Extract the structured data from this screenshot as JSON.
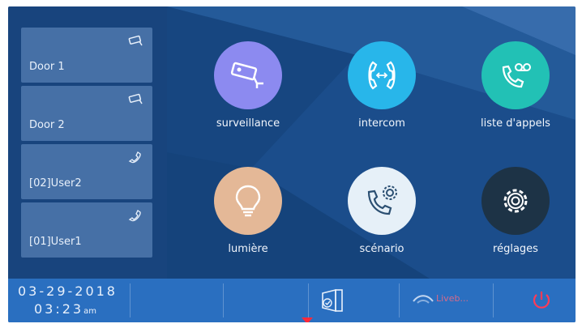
{
  "tiles": [
    {
      "label": "Door 1",
      "icon": "camera-icon"
    },
    {
      "label": "Door 2",
      "icon": "camera-icon"
    },
    {
      "label": "[02]User2",
      "icon": "phone-icon"
    },
    {
      "label": "[01]User1",
      "icon": "phone-icon"
    }
  ],
  "apps": [
    {
      "label": "surveillance",
      "color": "#8c8af0",
      "icon": "camera-icon"
    },
    {
      "label": "intercom",
      "color": "#28b6ea",
      "icon": "intercom-icon"
    },
    {
      "label": "liste d'appels",
      "color": "#22c1b5",
      "icon": "voicemail-icon"
    },
    {
      "label": "lumière",
      "color": "#e4b897",
      "icon": "bulb-icon"
    },
    {
      "label": "scénario",
      "color": "#e6f0f8",
      "icon": "scenario-icon"
    },
    {
      "label": "réglages",
      "color": "#1d3346",
      "icon": "gear-icon"
    }
  ],
  "status": {
    "date": "03-29-2018",
    "time": "03:23",
    "ampm": "am",
    "network": "Liveb...",
    "power_color": "#ff3b57"
  }
}
